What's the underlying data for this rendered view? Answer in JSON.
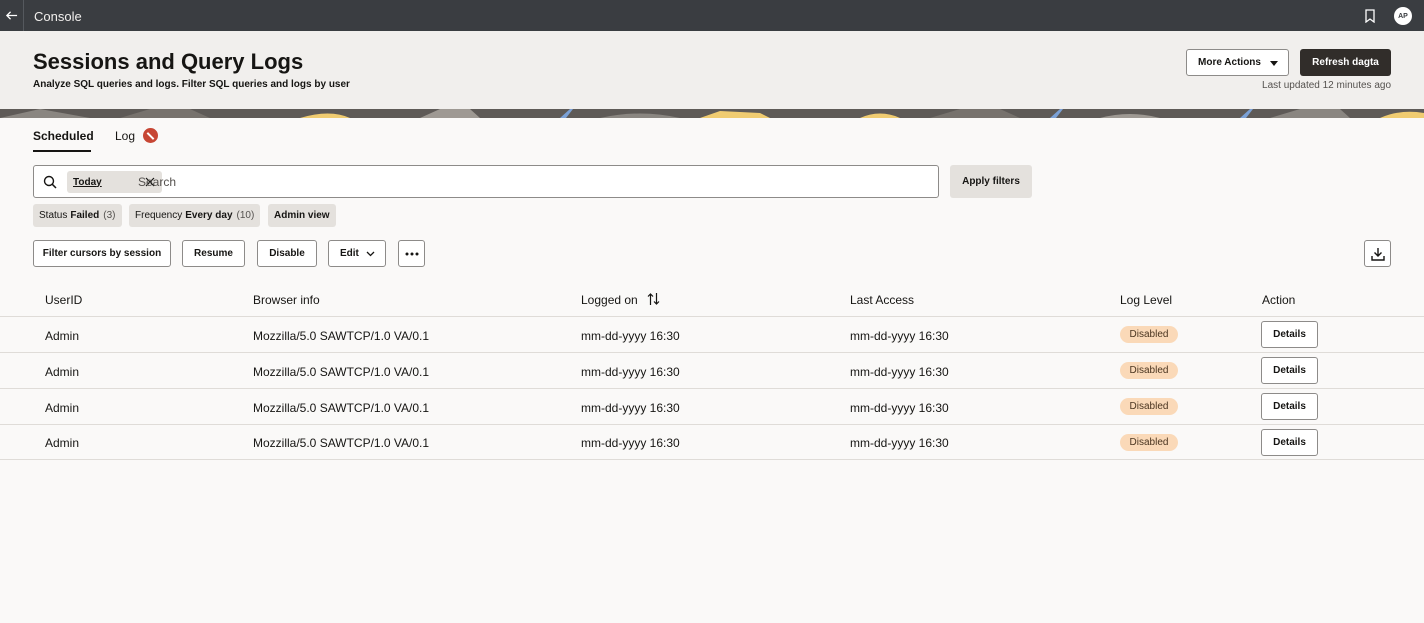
{
  "topbar": {
    "title": "Console",
    "avatar_initials": "AP"
  },
  "header": {
    "title": "Sessions and Query Logs",
    "subtitle": "Analyze SQL queries and logs. Filter SQL queries and logs by user",
    "more_actions_label": "More Actions",
    "refresh_label": "Refresh dagta",
    "last_updated": "Last updated 12 minutes ago"
  },
  "tabs": [
    {
      "label": "Scheduled",
      "selected": true
    },
    {
      "label": "Log",
      "has_error_badge": true
    }
  ],
  "search": {
    "chip_label": "Today",
    "placeholder": "Search",
    "value": "",
    "apply_label": "Apply filters"
  },
  "filter_chips": [
    {
      "name": "Status",
      "value": "Failed",
      "count": "(3)"
    },
    {
      "name": "Frequency",
      "value": "Every day",
      "count": "(10)"
    },
    {
      "name": "",
      "value": "Admin view",
      "count": ""
    }
  ],
  "toolbar": {
    "filter_cursors_label": "Filter cursors by session",
    "resume_label": "Resume",
    "disable_label": "Disable",
    "edit_label": "Edit"
  },
  "table": {
    "columns": [
      "UserID",
      "Browser info",
      "Logged on",
      "Last Access",
      "Log Level",
      "Action"
    ],
    "rows": [
      {
        "user": "Admin",
        "browser": "Mozzilla/5.0 SAWTCP/1.0 VA/0.1",
        "logged_on": "mm-dd-yyyy 16:30",
        "last_access": "mm-dd-yyyy 16:30",
        "log_level": "Disabled",
        "action": "Details"
      },
      {
        "user": "Admin",
        "browser": "Mozzilla/5.0 SAWTCP/1.0 VA/0.1",
        "logged_on": "mm-dd-yyyy 16:30",
        "last_access": "mm-dd-yyyy 16:30",
        "log_level": "Disabled",
        "action": "Details"
      },
      {
        "user": "Admin",
        "browser": "Mozzilla/5.0 SAWTCP/1.0 VA/0.1",
        "logged_on": "mm-dd-yyyy 16:30",
        "last_access": "mm-dd-yyyy 16:30",
        "log_level": "Disabled",
        "action": "Details"
      },
      {
        "user": "Admin",
        "browser": "Mozzilla/5.0 SAWTCP/1.0 VA/0.1",
        "logged_on": "mm-dd-yyyy 16:30",
        "last_access": "mm-dd-yyyy 16:30",
        "log_level": "Disabled",
        "action": "Details"
      }
    ]
  },
  "colors": {
    "topbar": "#3a3d41",
    "header_bg": "#f1efed",
    "primary_button": "#312d2a",
    "error_badge": "#c74634",
    "status_badge": "#fad9b8",
    "banner_accent_yellow": "#f0cc71",
    "banner_accent_blue": "#7ba1d6"
  },
  "icons": [
    "back-arrow-icon",
    "bookmark-icon",
    "search-icon",
    "close-icon",
    "chevron-down-icon",
    "more-dots-icon",
    "download-icon",
    "sort-icon",
    "error-icon"
  ]
}
